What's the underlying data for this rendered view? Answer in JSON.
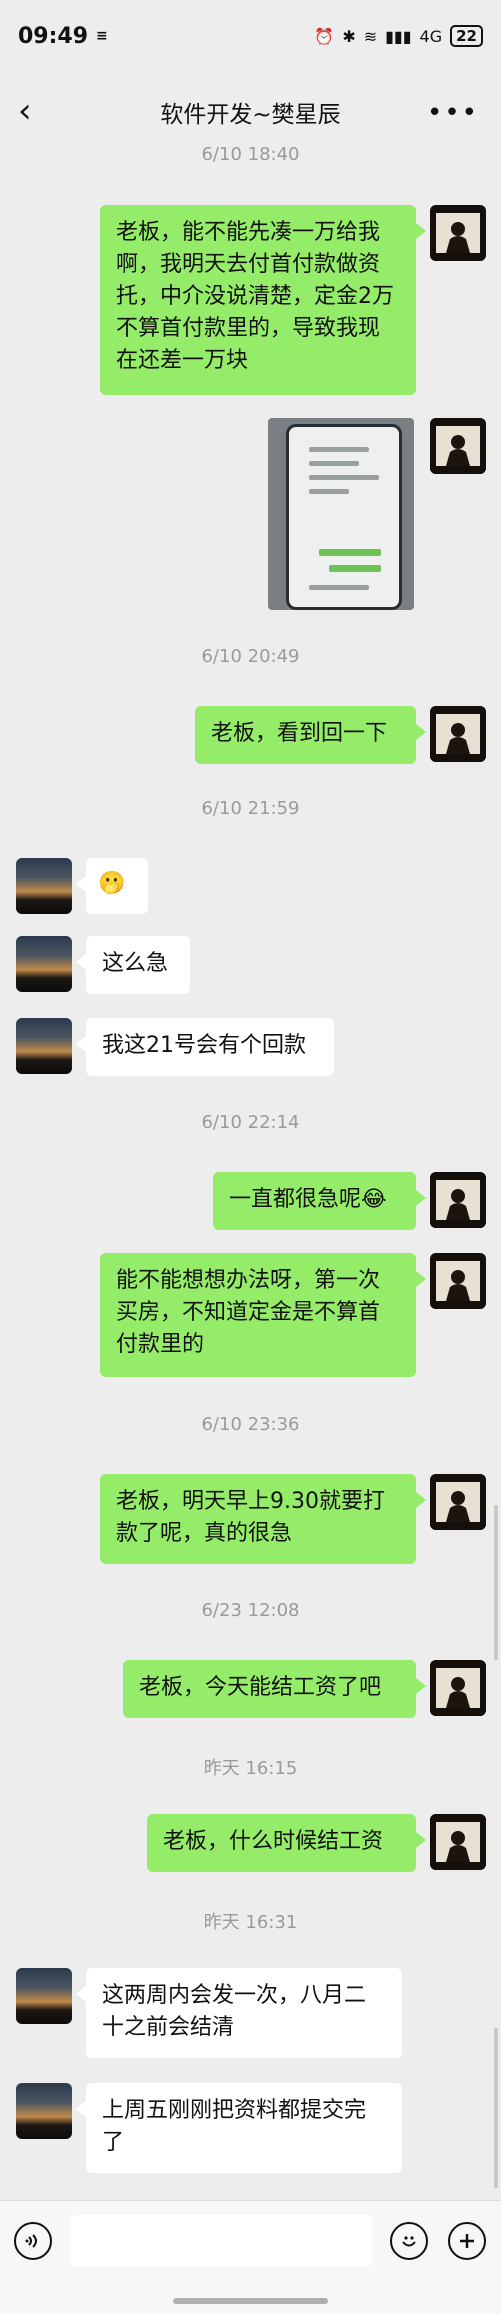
{
  "status": {
    "time": "09:49",
    "network": "4G",
    "battery": "22"
  },
  "nav": {
    "back_icon": "back-arrow-icon",
    "title": "软件开发~樊星辰",
    "more_icon": "more-icon"
  },
  "messages": [
    {
      "type": "time",
      "text": "6/10 18:40"
    },
    {
      "type": "me",
      "text": "老板，能不能先凑一万给我啊，我明天去付首付款做资托，中介没说清楚，定金2万不算首付款里的，导致我现在还差一万块"
    },
    {
      "type": "me-image",
      "text": ""
    },
    {
      "type": "time",
      "text": "6/10 20:49"
    },
    {
      "type": "me",
      "text": "老板，看到回一下"
    },
    {
      "type": "time",
      "text": "6/10 21:59"
    },
    {
      "type": "other",
      "text": "🫢"
    },
    {
      "type": "other",
      "text": "这么急"
    },
    {
      "type": "other",
      "text": "我这21号会有个回款"
    },
    {
      "type": "time",
      "text": "6/10 22:14"
    },
    {
      "type": "me",
      "text": "一直都很急呢😂"
    },
    {
      "type": "me",
      "text": "能不能想想办法呀，第一次买房，不知道定金是不算首付款里的"
    },
    {
      "type": "time",
      "text": "6/10 23:36"
    },
    {
      "type": "me",
      "text": "老板，明天早上9.30就要打款了呢，真的很急"
    },
    {
      "type": "time",
      "text": "6/23 12:08"
    },
    {
      "type": "me",
      "text": "老板，今天能结工资了吧"
    },
    {
      "type": "time",
      "text": "昨天 16:15"
    },
    {
      "type": "me",
      "text": "老板，什么时候结工资"
    },
    {
      "type": "time",
      "text": "昨天 16:31"
    },
    {
      "type": "other",
      "text": "这两周内会发一次，八月二十之前会结清"
    },
    {
      "type": "other",
      "text": "上周五刚刚把资料都提交完了"
    }
  ],
  "input": {
    "voice_icon": "voice-icon",
    "emoji_icon": "emoji-icon",
    "plus_icon": "plus-icon",
    "value": ""
  },
  "colors": {
    "background": "#ededed",
    "my_bubble": "#95ec69",
    "other_bubble": "#ffffff",
    "timestamp": "#9a9a9a"
  }
}
